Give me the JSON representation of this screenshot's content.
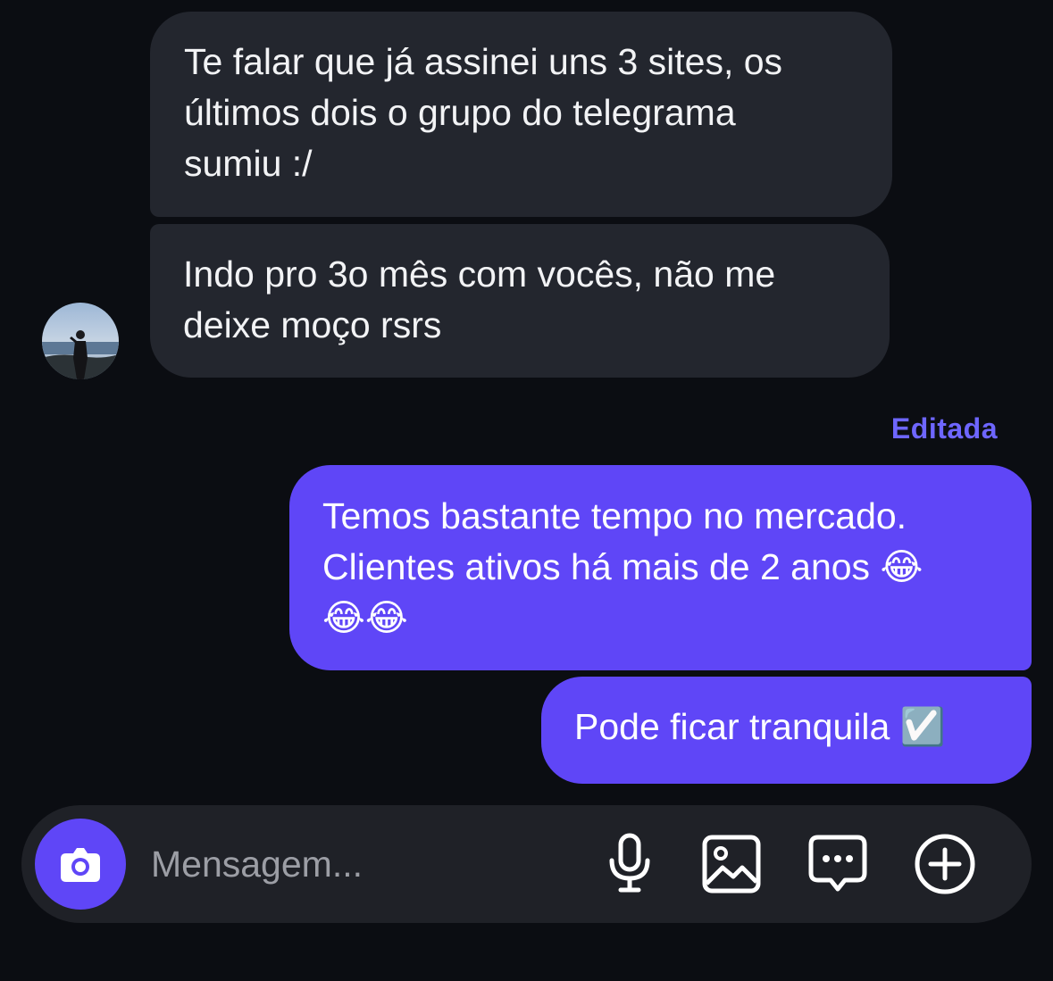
{
  "conversation": {
    "incoming_messages": [
      {
        "text": "Te falar que já assinei uns 3 sites, os\núltimos dois o grupo do telegrama\nsumiu :/"
      },
      {
        "text": "Indo pro 3o mês com vocês, não me\ndeixe moço rsrs"
      }
    ],
    "edited_label": "Editada",
    "outgoing_messages": [
      {
        "text": "Temos bastante tempo no mercado.\nClientes ativos há mais de 2 anos 😂\n😂😂"
      },
      {
        "text": "Pode ficar tranquila ☑️"
      }
    ]
  },
  "composer": {
    "placeholder": "Mensagem...",
    "value": "",
    "icons": [
      "camera-icon",
      "microphone-icon",
      "image-icon",
      "sticker-chat-icon",
      "plus-circle-icon"
    ]
  },
  "colors": {
    "background": "#0b0d12",
    "incoming_bubble": "#23262e",
    "outgoing_bubble": "#5f46f7",
    "edited_label": "#6e66ff",
    "composer_background": "#1f2127"
  }
}
